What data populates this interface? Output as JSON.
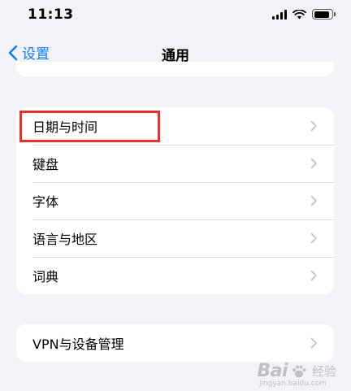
{
  "status_bar": {
    "time": "11:13",
    "icons": [
      "cellular-signal-icon",
      "wifi-icon",
      "battery-icon"
    ]
  },
  "nav": {
    "back_label": "设置",
    "title": "通用"
  },
  "groups": [
    {
      "rows": [
        {
          "label": "日期与时间"
        },
        {
          "label": "键盘"
        },
        {
          "label": "字体"
        },
        {
          "label": "语言与地区"
        },
        {
          "label": "词典"
        }
      ]
    },
    {
      "rows": [
        {
          "label": "VPN与设备管理"
        }
      ]
    }
  ],
  "annotation": {
    "color": "#e5322d",
    "target": "日期与时间"
  },
  "colors": {
    "accent": "#0a7aff",
    "background": "#f2f2f7",
    "chevron": "#c4c4c7"
  },
  "watermark": {
    "brand": "Bai",
    "brand_suffix": "经验",
    "url": "jingyan.baidu.com"
  }
}
